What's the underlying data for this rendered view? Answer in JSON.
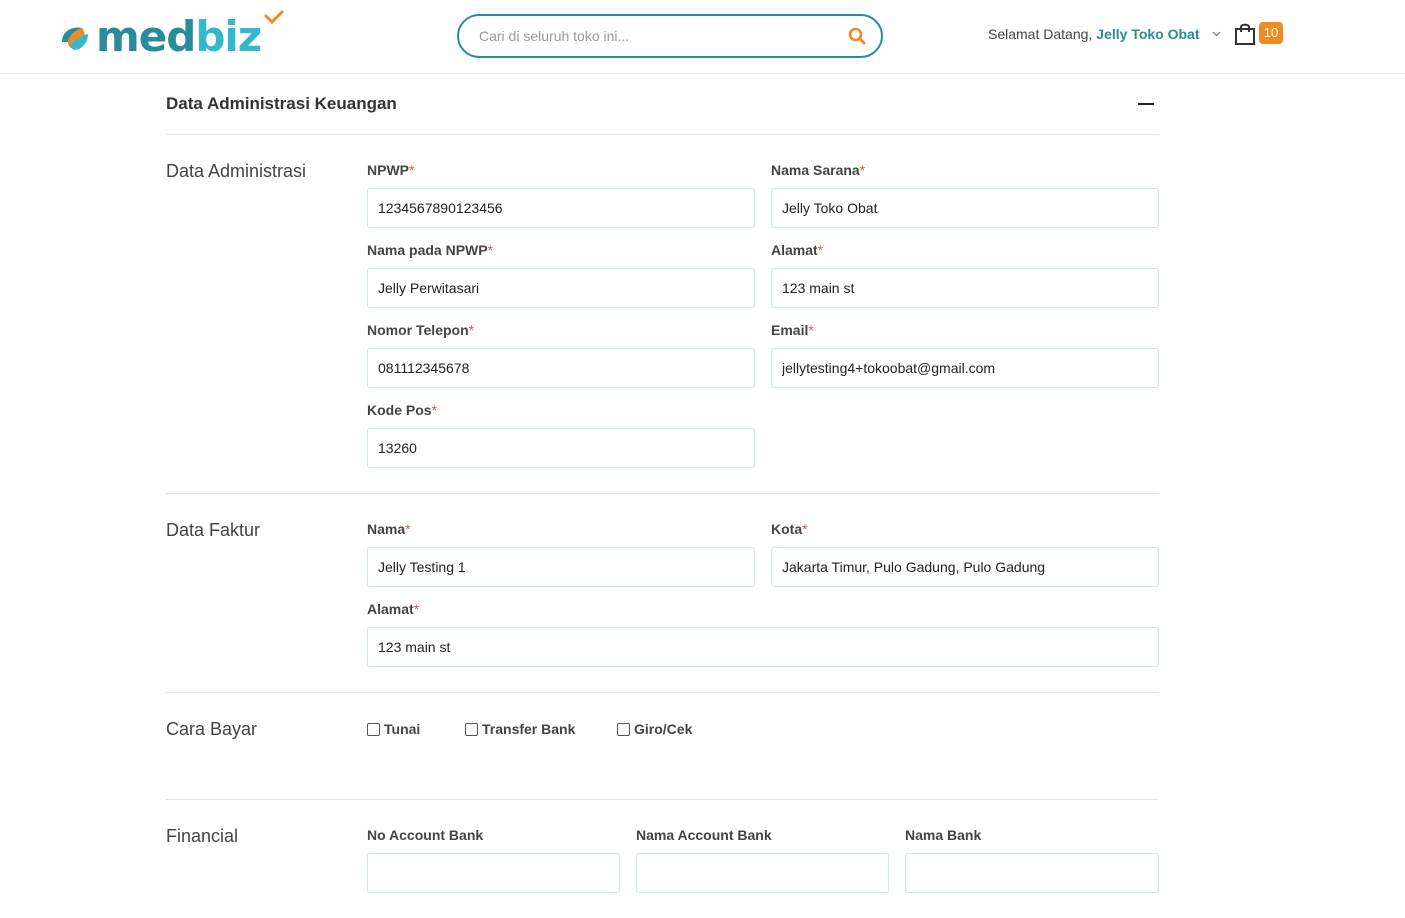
{
  "brand": {
    "name_part1": "med",
    "name_part2": "biz",
    "colors": {
      "primary": "#2a8c99",
      "secondary": "#33b8cc",
      "accent": "#f08a24"
    }
  },
  "header": {
    "search_placeholder": "Cari di seluruh toko ini...",
    "welcome_prefix": "Selamat Datang,",
    "welcome_user": "Jelly Toko Obat",
    "cart_count": "10"
  },
  "section": {
    "title": "Data Administrasi Keuangan"
  },
  "administrasi": {
    "title": "Data Administrasi",
    "npwp": {
      "label": "NPWP",
      "value": "1234567890123456"
    },
    "nama_sarana": {
      "label": "Nama Sarana",
      "value": "Jelly Toko Obat"
    },
    "nama_npwp": {
      "label": "Nama pada NPWP",
      "value": "Jelly Perwitasari"
    },
    "alamat": {
      "label": "Alamat",
      "value": "123 main st"
    },
    "telepon": {
      "label": "Nomor Telepon",
      "value": "081112345678"
    },
    "email": {
      "label": "Email",
      "value": "jellytesting4+tokoobat@gmail.com"
    },
    "kode_pos": {
      "label": "Kode Pos",
      "value": "13260"
    }
  },
  "faktur": {
    "title": "Data Faktur",
    "nama": {
      "label": "Nama",
      "value": "Jelly Testing 1"
    },
    "kota": {
      "label": "Kota",
      "value": "Jakarta Timur, Pulo Gadung, Pulo Gadung"
    },
    "alamat": {
      "label": "Alamat",
      "value": "123 main st"
    }
  },
  "cara_bayar": {
    "title": "Cara Bayar",
    "options": [
      "Tunai",
      "Transfer Bank",
      "Giro/Cek"
    ]
  },
  "financial": {
    "title": "Financial",
    "no_account": {
      "label": "No Account Bank",
      "value": ""
    },
    "nama_account": {
      "label": "Nama Account Bank",
      "value": ""
    },
    "nama_bank": {
      "label": "Nama Bank",
      "value": ""
    }
  },
  "required_mark": "*",
  "icons": {
    "search": "search-icon",
    "chevron": "chevron-down-icon",
    "cart": "shopping-bag-icon",
    "collapse": "minus-icon"
  }
}
